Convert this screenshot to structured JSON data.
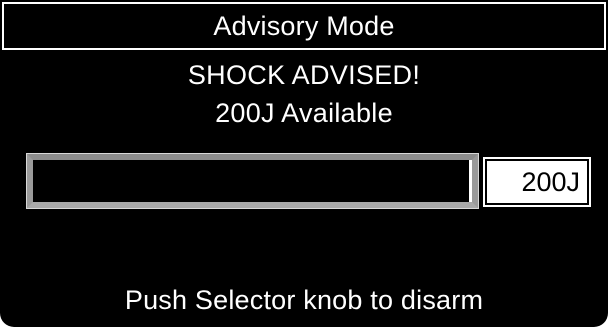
{
  "header": {
    "title": "Advisory Mode"
  },
  "status": {
    "line1": "SHOCK ADVISED!",
    "line2": "200J Available"
  },
  "charge": {
    "progress": 0,
    "energy_label": "200J"
  },
  "footer": {
    "instruction": "Push Selector knob to disarm"
  },
  "colors": {
    "background": "#000000",
    "text": "#ffffff",
    "bar_frame": "#9a9a9a"
  }
}
